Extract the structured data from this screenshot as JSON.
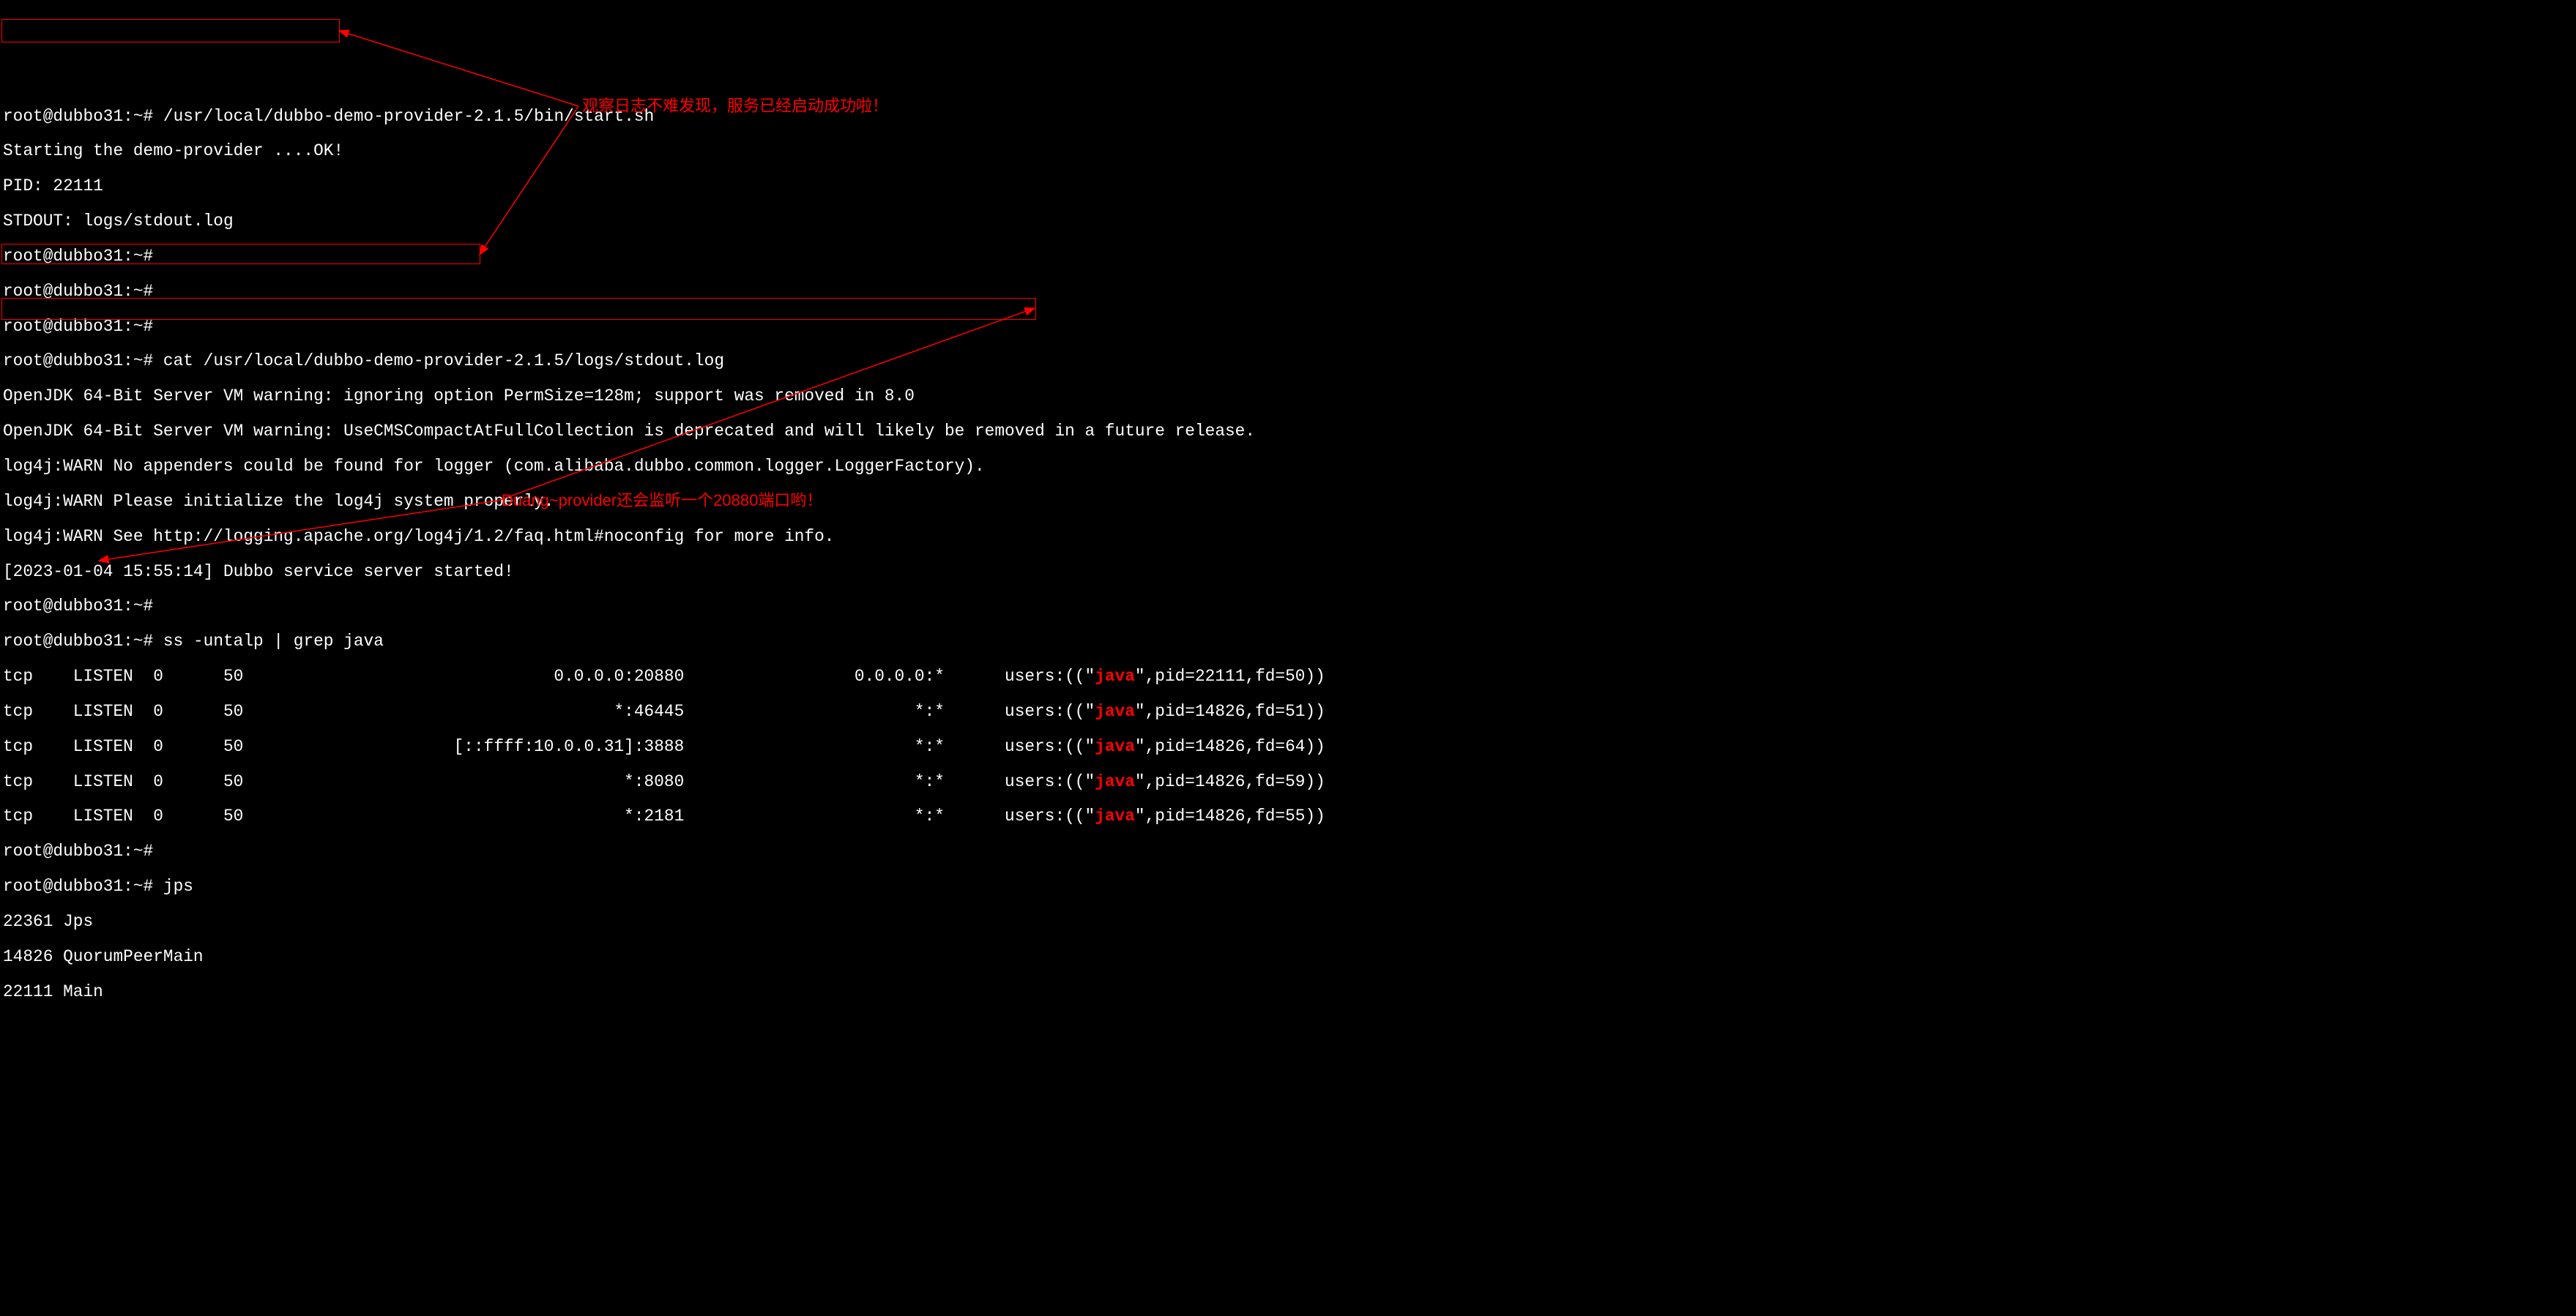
{
  "prompt_host": "root@dubbo31",
  "prompt_dir": "~",
  "prompt_marker": "#",
  "cmd_start": "/usr/local/dubbo-demo-provider-2.1.5/bin/start.sh",
  "start_out1": "Starting the demo-provider ....OK!",
  "start_out2": "PID: 22111",
  "start_out3": "STDOUT: logs/stdout.log",
  "cmd_cat": "cat /usr/local/dubbo-demo-provider-2.1.5/logs/stdout.log",
  "cat_l1": "OpenJDK 64-Bit Server VM warning: ignoring option PermSize=128m; support was removed in 8.0",
  "cat_l2": "OpenJDK 64-Bit Server VM warning: UseCMSCompactAtFullCollection is deprecated and will likely be removed in a future release.",
  "cat_l3": "log4j:WARN No appenders could be found for logger (com.alibaba.dubbo.common.logger.LoggerFactory).",
  "cat_l4": "log4j:WARN Please initialize the log4j system properly.",
  "cat_l5": "log4j:WARN See http://logging.apache.org/log4j/1.2/faq.html#noconfig for more info.",
  "cat_l6": "[2023-01-04 15:55:14] Dubbo service server started!",
  "cmd_ss": "ss -untalp | grep java",
  "ss_rows": [
    {
      "proto": "tcp",
      "state": "LISTEN",
      "recvq": "0",
      "sendq": "50",
      "local": "0.0.0.0:20880",
      "peer": "0.0.0.0:*",
      "pre": "users:((\"",
      "hl": "java",
      "post": "\",pid=22111,fd=50))"
    },
    {
      "proto": "tcp",
      "state": "LISTEN",
      "recvq": "0",
      "sendq": "50",
      "local": "*:46445",
      "peer": "*:*",
      "pre": "users:((\"",
      "hl": "java",
      "post": "\",pid=14826,fd=51))"
    },
    {
      "proto": "tcp",
      "state": "LISTEN",
      "recvq": "0",
      "sendq": "50",
      "local": "[::ffff:10.0.0.31]:3888",
      "peer": "*:*",
      "pre": "users:((\"",
      "hl": "java",
      "post": "\",pid=14826,fd=64))"
    },
    {
      "proto": "tcp",
      "state": "LISTEN",
      "recvq": "0",
      "sendq": "50",
      "local": "*:8080",
      "peer": "*:*",
      "pre": "users:((\"",
      "hl": "java",
      "post": "\",pid=14826,fd=59))"
    },
    {
      "proto": "tcp",
      "state": "LISTEN",
      "recvq": "0",
      "sendq": "50",
      "local": "*:2181",
      "peer": "*:*",
      "pre": "users:((\"",
      "hl": "java",
      "post": "\",pid=14826,fd=55))"
    }
  ],
  "cmd_jps": "jps",
  "jps_l1": "22361 Jps",
  "jps_l2": "14826 QuorumPeerMain",
  "jps_l3": "22111 Main",
  "anno1": "观察日志不难发现，服务已经启动成功啦！",
  "anno2": "Duang~provider还会监听一个20880端口哟！"
}
